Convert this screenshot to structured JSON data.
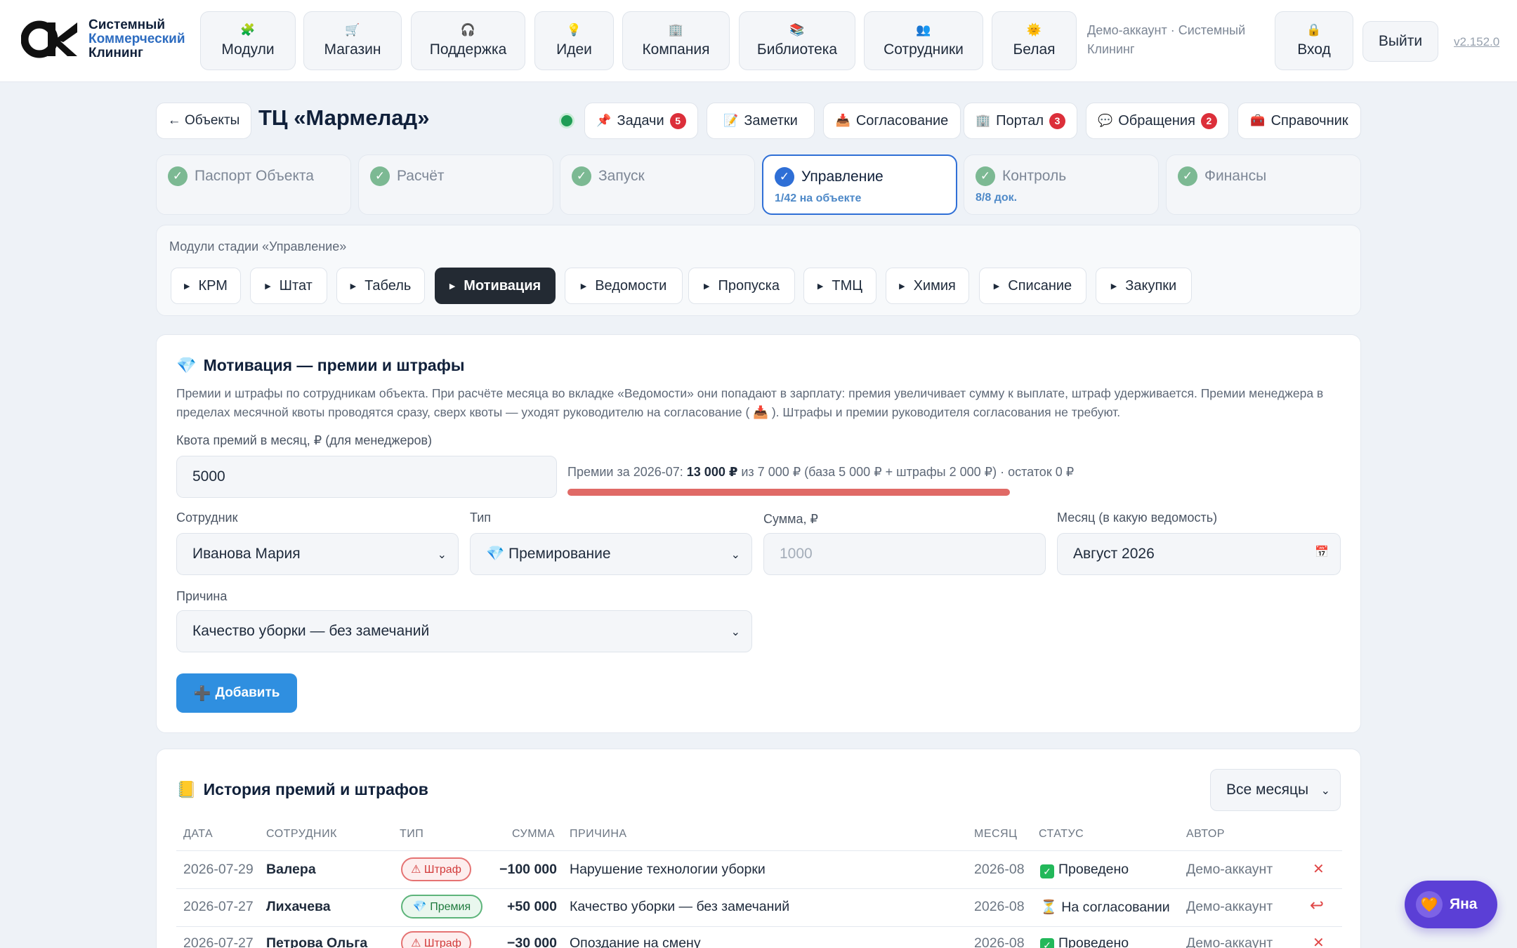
{
  "brand": {
    "line1": "Системный",
    "line2": "Коммерческий",
    "line3": "Клининг"
  },
  "nav": [
    {
      "label": "Модули",
      "icon": "🧩"
    },
    {
      "label": "Магазин",
      "icon": "🛒"
    },
    {
      "label": "Поддержка",
      "icon": "🎧"
    },
    {
      "label": "Идеи",
      "icon": "💡"
    },
    {
      "label": "Компания",
      "icon": "🏢"
    },
    {
      "label": "Библиотека",
      "icon": "📚"
    },
    {
      "label": "Сотрудники",
      "icon": "👥"
    },
    {
      "label": "Белая",
      "icon": "🌞"
    }
  ],
  "account": {
    "label": "Демо-аккаунт · Системный Клининг",
    "login_label": "Вход",
    "login_icon": "🔒",
    "exit_label": "Выйти",
    "version": "v2.152.0"
  },
  "header": {
    "back_label": "← Объекты",
    "title": "ТЦ «Мармелад»",
    "buttons": [
      {
        "label": "Задачи",
        "icon": "📌",
        "badge": "5"
      },
      {
        "label": "Заметки",
        "icon": "📝",
        "badge": ""
      },
      {
        "label": "Согласование",
        "icon": "📥",
        "badge": ""
      },
      {
        "label": "Портал",
        "icon": "🏢",
        "badge": "3"
      },
      {
        "label": "Обращения",
        "icon": "💬",
        "badge": "2"
      },
      {
        "label": "Справочник",
        "icon": "🧰",
        "badge": ""
      }
    ]
  },
  "stages": [
    {
      "label": "Паспорт Объекта",
      "sub": ""
    },
    {
      "label": "Расчёт",
      "sub": ""
    },
    {
      "label": "Запуск",
      "sub": ""
    },
    {
      "label": "Управление",
      "sub": "1/42 на объекте"
    },
    {
      "label": "Контроль",
      "sub": "8/8 док."
    },
    {
      "label": "Финансы",
      "sub": ""
    }
  ],
  "modules": {
    "caption": "Модули стадии «Управление»",
    "items": [
      "КРМ",
      "Штат",
      "Табель",
      "Мотивация",
      "Ведомости",
      "Пропуска",
      "ТМЦ",
      "Химия",
      "Списание",
      "Закупки"
    ],
    "active": "Мотивация"
  },
  "motivation": {
    "title": "Мотивация — премии и штрафы",
    "title_icon": "💎",
    "description": "Премии и штрафы по сотрудникам объекта. При расчёте месяца во вкладке «Ведомости» они попадают в зарплату: премия увеличивает сумму к выплате, штраф удерживается. Премии менеджера в пределах месячной квоты проводятся сразу, сверх квоты — уходят руководителю на согласование ( 📥 ). Штрафы и премии руководителя согласования не требуют.",
    "quota_label": "Квота премий в месяц, ₽ (для менеджеров)",
    "quota_value": "5000",
    "quota_info_prefix": "Премии за 2026-07: ",
    "quota_info_bold": "13 000 ₽",
    "quota_info_suffix": " из 7 000 ₽ (база 5 000 ₽ + штрафы 2 000 ₽) · остаток 0 ₽",
    "quota_used_fraction": 1.0,
    "quota_color": "#e06a66",
    "employee_label": "Сотрудник",
    "employee_value": "Иванова Мария",
    "type_label": "Тип",
    "type_value": "💎 Премирование",
    "amount_label": "Сумма, ₽",
    "amount_placeholder": "1000",
    "month_label": "Месяц (в какую ведомость)",
    "month_value": "Август 2026",
    "reason_label": "Причина",
    "reason_value": "Качество уборки — без замечаний",
    "add_label": "Добавить",
    "add_icon": "➕"
  },
  "history": {
    "title": "История премий и штрафов",
    "title_icon": "📒",
    "filter": "Все месяцы",
    "columns": [
      "ДАТА",
      "СОТРУДНИК",
      "ТИП",
      "СУММА",
      "ПРИЧИНА",
      "МЕСЯЦ",
      "СТАТУС",
      "АВТОР"
    ],
    "rows": [
      {
        "date": "2026-07-29",
        "employee": "Валера",
        "type": "⚠ Штраф",
        "kind": "fine",
        "amount": "−100 000",
        "reason": "Нарушение технологии уборки",
        "month": "2026-08",
        "status_icon": "✓",
        "status": "Проведено",
        "author": "Демо-аккаунт",
        "action": "✕"
      },
      {
        "date": "2026-07-27",
        "employee": "Лихачева",
        "type": "💎 Премия",
        "kind": "bonus",
        "amount": "+50 000",
        "reason": "Качество уборки — без замечаний",
        "month": "2026-08",
        "status_icon": "⏳",
        "status": "На согласовании",
        "author": "Демо-аккаунт",
        "action": "↩"
      },
      {
        "date": "2026-07-27",
        "employee": "Петрова Ольга",
        "type": "⚠ Штраф",
        "kind": "fine",
        "amount": "−30 000",
        "reason": "Опоздание на смену",
        "month": "2026-08",
        "status_icon": "✓",
        "status": "Проведено",
        "author": "Демо-аккаунт",
        "action": "✕"
      }
    ]
  },
  "assistant": {
    "label": "Яна",
    "icon": "🧡"
  }
}
